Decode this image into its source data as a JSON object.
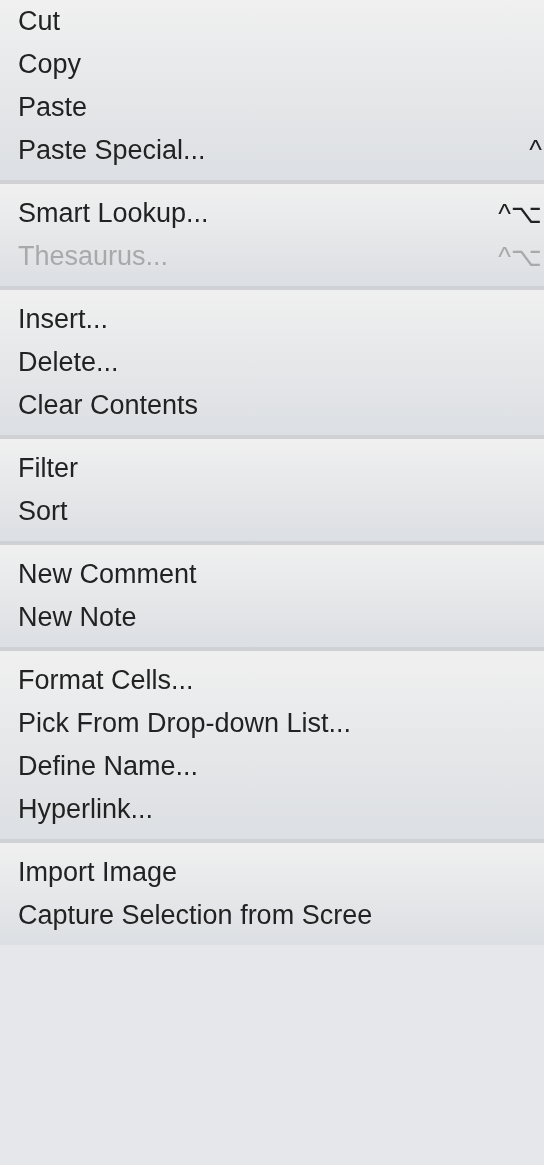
{
  "menu": {
    "groups": [
      {
        "items": [
          {
            "label": "Cut",
            "disabled": false
          },
          {
            "label": "Copy",
            "disabled": false
          },
          {
            "label": "Paste",
            "disabled": false
          },
          {
            "label": "Paste Special...",
            "disabled": false,
            "shortcut": "^"
          }
        ]
      },
      {
        "items": [
          {
            "label": "Smart Lookup...",
            "disabled": false,
            "shortcut": "^⌥"
          },
          {
            "label": "Thesaurus...",
            "disabled": true,
            "shortcut": "^⌥"
          }
        ]
      },
      {
        "items": [
          {
            "label": "Insert...",
            "disabled": false
          },
          {
            "label": "Delete...",
            "disabled": false
          },
          {
            "label": "Clear Contents",
            "disabled": false
          }
        ]
      },
      {
        "items": [
          {
            "label": "Filter",
            "disabled": false
          },
          {
            "label": "Sort",
            "disabled": false
          }
        ]
      },
      {
        "items": [
          {
            "label": "New Comment",
            "disabled": false
          },
          {
            "label": "New Note",
            "disabled": false
          }
        ]
      },
      {
        "items": [
          {
            "label": "Format Cells...",
            "disabled": false
          },
          {
            "label": "Pick From Drop-down List...",
            "disabled": false
          },
          {
            "label": "Define Name...",
            "disabled": false
          },
          {
            "label": "Hyperlink...",
            "disabled": false
          }
        ]
      },
      {
        "items": [
          {
            "label": "Import Image",
            "disabled": false
          },
          {
            "label": "Capture Selection from Scree",
            "disabled": false
          }
        ]
      }
    ]
  }
}
